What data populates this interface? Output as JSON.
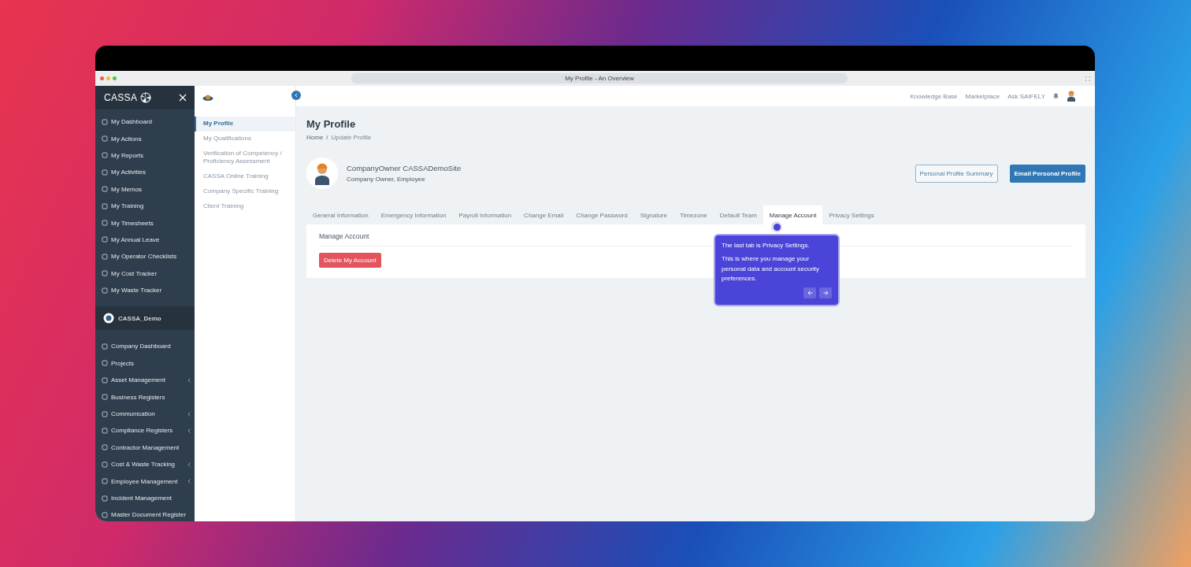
{
  "browser": {
    "title": "My Profile - An Overview"
  },
  "sidebar": {
    "logo": "CASSA",
    "personal_items": [
      {
        "label": "My Dashboard"
      },
      {
        "label": "My Actions"
      },
      {
        "label": "My Reports"
      },
      {
        "label": "My Activities"
      },
      {
        "label": "My Memos"
      },
      {
        "label": "My Training"
      },
      {
        "label": "My Timesheets"
      },
      {
        "label": "My Annual Leave"
      },
      {
        "label": "My Operator Checklists"
      },
      {
        "label": "My Cost Tracker"
      },
      {
        "label": "My Waste Tracker"
      }
    ],
    "company": {
      "name": "CASSA_Demo"
    },
    "company_items": [
      {
        "label": "Company Dashboard",
        "expandable": false
      },
      {
        "label": "Projects",
        "expandable": false
      },
      {
        "label": "Asset Management",
        "expandable": true
      },
      {
        "label": "Business Registers",
        "expandable": false
      },
      {
        "label": "Communication",
        "expandable": true
      },
      {
        "label": "Compliance Registers",
        "expandable": true
      },
      {
        "label": "Contractor Management",
        "expandable": false
      },
      {
        "label": "Cost & Waste Tracking",
        "expandable": true
      },
      {
        "label": "Employee Management",
        "expandable": true
      },
      {
        "label": "Incident Management",
        "expandable": false
      },
      {
        "label": "Master Document Register",
        "expandable": false
      }
    ]
  },
  "subnav": {
    "items": [
      {
        "label": "My Profile",
        "selected": true
      },
      {
        "label": "My Qualifications",
        "selected": false
      },
      {
        "label": "Verification of Competency / Proficiency Assessment",
        "selected": false
      },
      {
        "label": "CASSA Online Training",
        "selected": false
      },
      {
        "label": "Company Specific Training",
        "selected": false
      },
      {
        "label": "Client Training",
        "selected": false
      }
    ]
  },
  "topbar": {
    "links": [
      "Knowledge Base",
      "Marketplace",
      "Ask SAIFELY"
    ]
  },
  "page": {
    "title": "My Profile",
    "breadcrumb": [
      "Home",
      "Update Profile"
    ],
    "breadcrumb_separator": "/"
  },
  "profile": {
    "name": "CompanyOwner CASSADemoSite",
    "roles": "Company Owner, Employee",
    "buttons": [
      {
        "label": "Personal Profile Summary",
        "kind": "outline"
      },
      {
        "label": "Email Personal Profile",
        "kind": "primary"
      }
    ]
  },
  "tabs": [
    {
      "label": "General Information",
      "selected": false
    },
    {
      "label": "Emergency Information",
      "selected": false
    },
    {
      "label": "Payroll Information",
      "selected": false
    },
    {
      "label": "Change Email",
      "selected": false
    },
    {
      "label": "Change Password",
      "selected": false
    },
    {
      "label": "Signature",
      "selected": false
    },
    {
      "label": "Timezone",
      "selected": false
    },
    {
      "label": "Default Team",
      "selected": false
    },
    {
      "label": "Manage Account",
      "selected": true
    },
    {
      "label": "Privacy Settings",
      "selected": false
    }
  ],
  "panel": {
    "title": "Manage Account",
    "button": "Delete My Account"
  },
  "tour": {
    "title": "The last tab is Privacy Settings.",
    "body": "This is where you manage your personal data and account security preferences."
  }
}
